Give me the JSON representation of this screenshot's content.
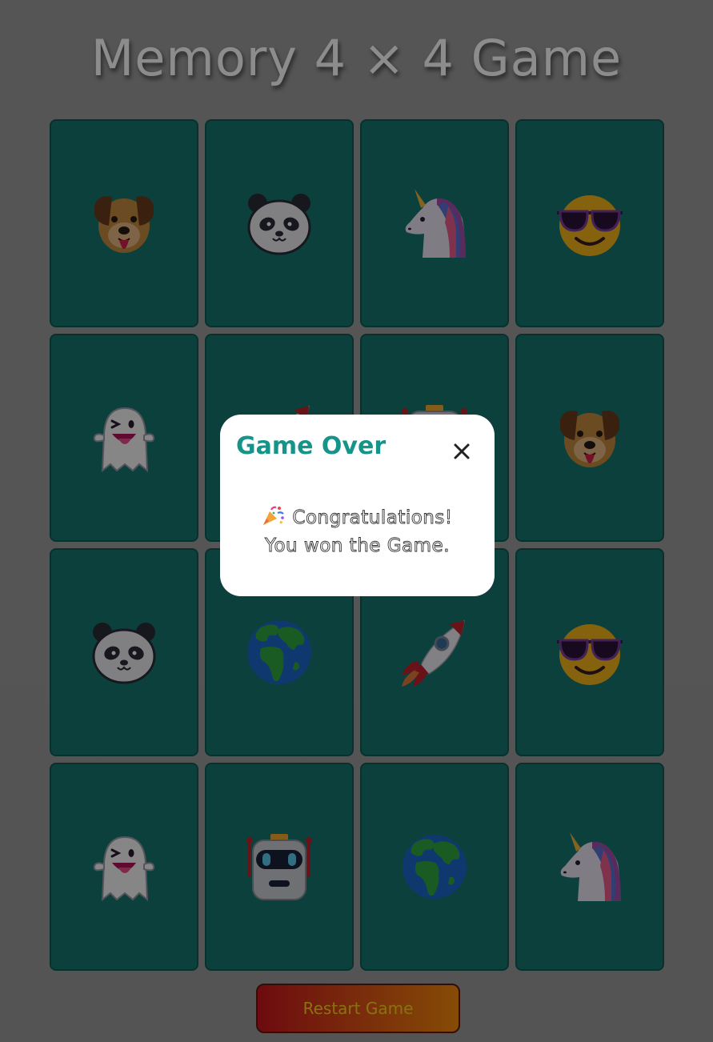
{
  "title": "Memory 4 × 4 Game",
  "board": {
    "rows": 4,
    "cols": 4,
    "cards": [
      {
        "icon": "dog-face-icon"
      },
      {
        "icon": "panda-face-icon"
      },
      {
        "icon": "unicorn-icon"
      },
      {
        "icon": "sunglasses-face-icon"
      },
      {
        "icon": "ghost-icon"
      },
      {
        "icon": "rocket-icon"
      },
      {
        "icon": "robot-icon"
      },
      {
        "icon": "dog-face-icon"
      },
      {
        "icon": "panda-face-icon"
      },
      {
        "icon": "globe-africa-icon"
      },
      {
        "icon": "rocket-icon"
      },
      {
        "icon": "sunglasses-face-icon"
      },
      {
        "icon": "ghost-icon"
      },
      {
        "icon": "robot-icon"
      },
      {
        "icon": "globe-africa-icon"
      },
      {
        "icon": "unicorn-icon"
      }
    ]
  },
  "restart_button": {
    "label": "Restart Game"
  },
  "modal": {
    "title": "Game Over",
    "close_icon": "close-icon",
    "message_icon": "party-popper-icon",
    "message_line1": "Congratulations!",
    "message_line2": "You won the Game."
  },
  "colors": {
    "card": "#16766d",
    "card_border": "#0f5a53",
    "modal_title": "#16948a",
    "restart_start": "#c8151e",
    "restart_end": "#f28a0c",
    "restart_text": "#f6d21e"
  }
}
